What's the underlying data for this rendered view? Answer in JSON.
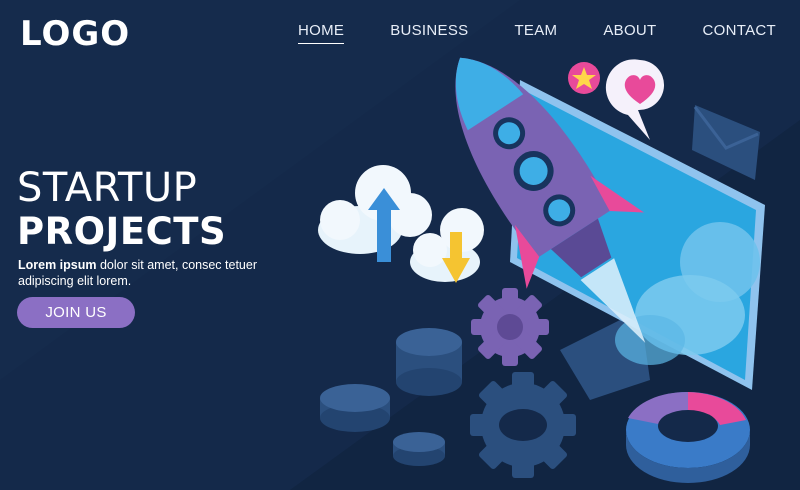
{
  "header": {
    "logo": "LOGO",
    "nav": [
      {
        "label": "HOME",
        "active": true
      },
      {
        "label": "BUSINESS",
        "active": false
      },
      {
        "label": "TEAM",
        "active": false
      },
      {
        "label": "ABOUT",
        "active": false
      },
      {
        "label": "CONTACT",
        "active": false
      }
    ]
  },
  "hero": {
    "title_line1": "STARTUP",
    "title_line2": "PROJECTS",
    "text_bold": "Lorem ipsum",
    "text_rest": " dolor sit amet, consec tetuer adipiscing elit lorem.",
    "cta_label": "JOIN US"
  },
  "colors": {
    "background": "#14294a",
    "accent_purple": "#8b6fc4",
    "screen_blue": "#29a8e0",
    "pink": "#e84a9a"
  },
  "icons": [
    "rocket-icon",
    "upload-cloud-icon",
    "download-cloud-icon",
    "gear-icon",
    "star-icon",
    "heart-icon",
    "mail-icon",
    "pie-chart-icon",
    "monitor-icon"
  ]
}
